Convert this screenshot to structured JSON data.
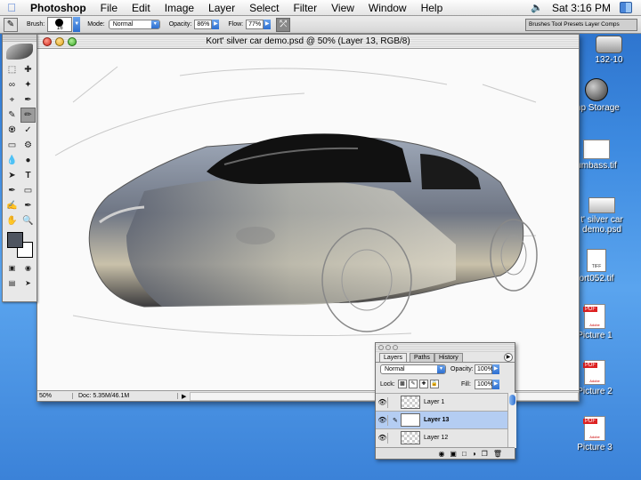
{
  "menubar": {
    "app": "Photoshop",
    "items": [
      "File",
      "Edit",
      "Image",
      "Layer",
      "Select",
      "Filter",
      "View",
      "Window",
      "Help"
    ],
    "clock": "Sat 3:16 PM"
  },
  "options": {
    "brush_label": "Brush:",
    "brush_size": "16",
    "mode_label": "Mode:",
    "mode_value": "Normal",
    "opacity_label": "Opacity:",
    "opacity_value": "86%",
    "flow_label": "Flow:",
    "flow_value": "77%",
    "well_label": "Brushes Tool Presets Layer Comps"
  },
  "document": {
    "title": "Kort' silver car demo.psd @ 50% (Layer 13, RGB/8)",
    "zoom": "50%",
    "doc_size": "Doc: 5.35M/46.1M"
  },
  "desktop": {
    "icons": [
      "132-10",
      "mp Storage",
      "umbass.tif",
      "t' silver car demo.psd",
      "ort052.tif",
      "Picture 1",
      "Picture 2",
      "Picture 3"
    ],
    "pdf_badge": "PDF",
    "adobe": "Adobe",
    "tiff": "TIFF"
  },
  "layers_panel": {
    "tabs": [
      "Layers",
      "Paths",
      "History"
    ],
    "blend_mode": "Normal",
    "opacity_label": "Opacity:",
    "opacity_value": "100%",
    "lock_label": "Lock:",
    "fill_label": "Fill:",
    "fill_value": "100%",
    "layers": [
      {
        "name": "Layer 1",
        "active": false
      },
      {
        "name": "Layer 13",
        "active": true
      },
      {
        "name": "Layer 12",
        "active": false
      }
    ]
  },
  "colors": {
    "accent": "#3b7fdc",
    "desktop": "#3d8ae0",
    "active_layer": "#b4cdf2",
    "car_body": "#8a9099"
  }
}
